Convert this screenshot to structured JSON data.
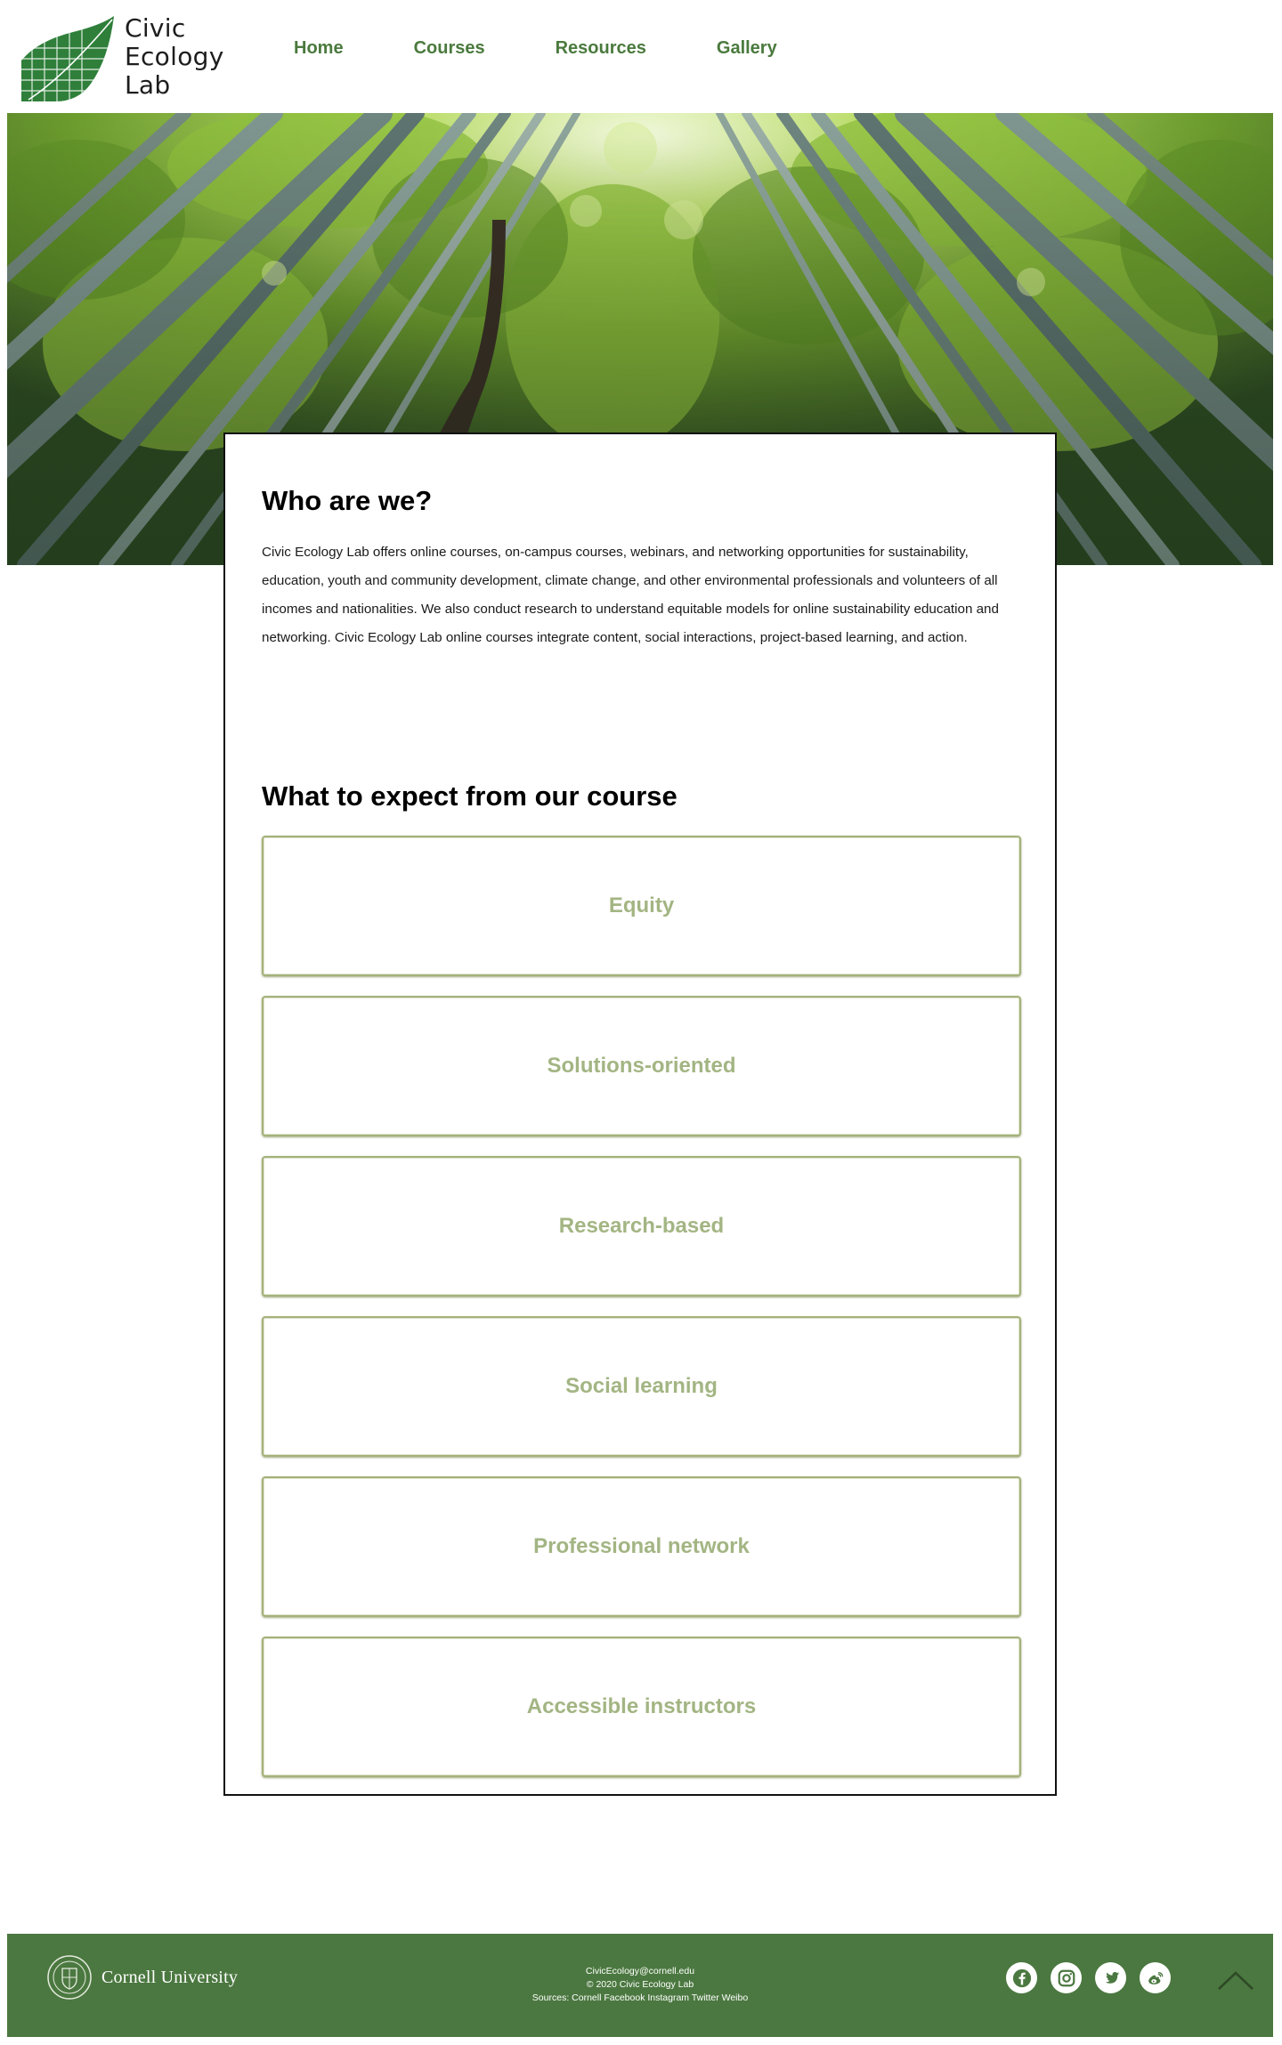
{
  "brand": {
    "line1": "Civic",
    "line2": "Ecology",
    "line3": "Lab",
    "color": "#2f7f3a"
  },
  "nav": {
    "items": [
      {
        "label": "Home"
      },
      {
        "label": "Courses"
      },
      {
        "label": "Resources"
      },
      {
        "label": "Gallery"
      }
    ],
    "color": "#4a7a3d"
  },
  "hero": {
    "icon": "bamboo-forest-image"
  },
  "about": {
    "title": "Who are we?",
    "text": "Civic Ecology Lab offers online courses, on-campus courses, webinars, and networking opportunities for sustainability, education, youth and community development, climate change, and other environmental professionals and volunteers of all incomes and nationalities. We also conduct research to understand equitable models for online sustainability education and networking. Civic Ecology Lab online courses integrate content, social interactions, project-based learning, and action."
  },
  "expect": {
    "title": "What to expect from our course",
    "items": [
      {
        "label": "Equity"
      },
      {
        "label": "Solutions-oriented"
      },
      {
        "label": "Research-based"
      },
      {
        "label": "Social learning"
      },
      {
        "label": "Professional network"
      },
      {
        "label": "Accessible instructors"
      }
    ],
    "border_color": "#a4b27a",
    "text_color": "#a3b583"
  },
  "footer": {
    "university": "Cornell University",
    "email": "CivicEcology@cornell.edu",
    "copyright": "© 2020 Civic Ecology Lab",
    "sources": "Sources: Cornell Facebook Instagram Twitter Weibo",
    "background": "#4b7840",
    "socials": [
      {
        "icon": "facebook-icon"
      },
      {
        "icon": "instagram-icon"
      },
      {
        "icon": "twitter-icon"
      },
      {
        "icon": "weibo-icon"
      }
    ],
    "back_to_top_icon": "chevron-up-icon"
  }
}
